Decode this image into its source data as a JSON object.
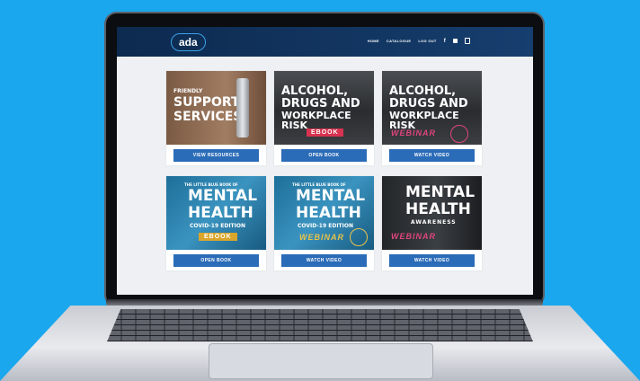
{
  "header": {
    "logo_text": "ada",
    "nav": [
      "HOME",
      "CATALOGUE",
      "LOG OUT"
    ],
    "icons": [
      "facebook-icon",
      "linkedin-icon",
      "cart-icon"
    ]
  },
  "cards": [
    {
      "line1": "FRIENDLY",
      "line2": "SUPPORT",
      "line3": "SERVICES",
      "badge": "",
      "button": "VIEW RESOURCES"
    },
    {
      "line1": "ALCOHOL,",
      "line2": "DRUGS AND",
      "line3": "WORKPLACE RISK",
      "badge": "EBOOK",
      "button": "OPEN BOOK"
    },
    {
      "line1": "ALCOHOL,",
      "line2": "DRUGS AND",
      "line3": "WORKPLACE RISK",
      "badge": "WEBINAR",
      "button": "WATCH VIDEO"
    },
    {
      "kicker": "THE LITTLE BLUE BOOK OF",
      "line1": "MENTAL",
      "line2": "HEALTH",
      "line3": "COVID-19 EDITION",
      "badge": "EBOOK",
      "button": "OPEN BOOK"
    },
    {
      "kicker": "THE LITTLE BLUE BOOK OF",
      "line1": "MENTAL",
      "line2": "HEALTH",
      "line3": "COVID-19 EDITION",
      "badge": "WEBINAR",
      "button": "WATCH VIDEO"
    },
    {
      "line1": "MENTAL",
      "line2": "HEALTH",
      "line3": "AWARENESS",
      "badge": "WEBINAR",
      "button": "WATCH VIDEO"
    }
  ]
}
